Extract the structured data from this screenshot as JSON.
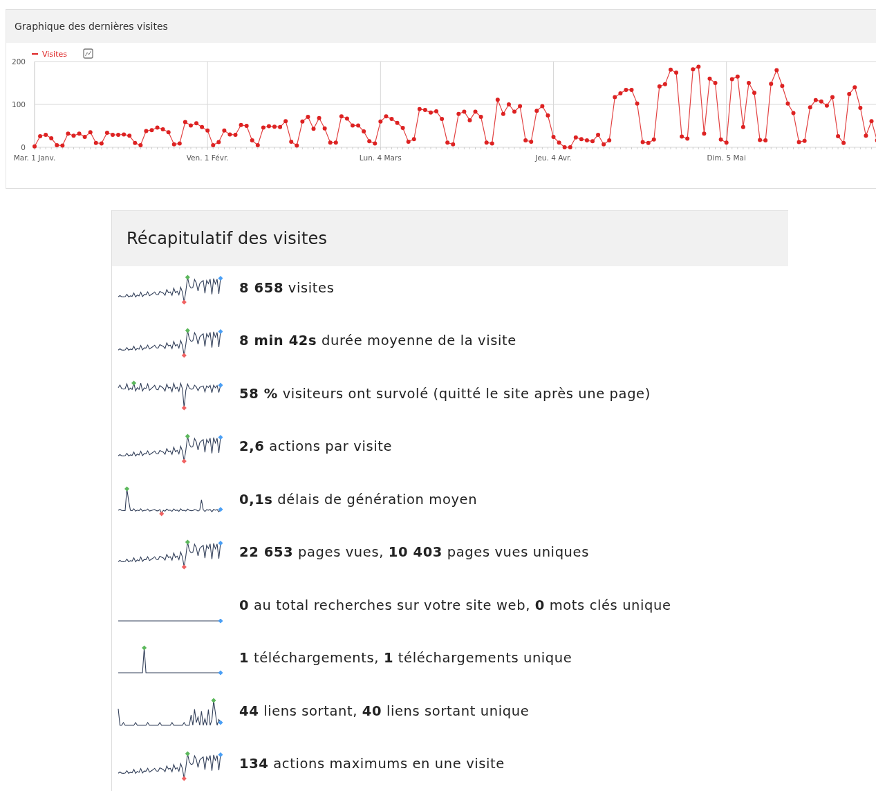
{
  "chart_panel": {
    "title": "Graphique des dernières visites",
    "chart_data": {
      "type": "line",
      "ylim": [
        0,
        200
      ],
      "yticks": [
        0,
        100,
        200
      ],
      "categories": [
        "Mar. 1 Janv.",
        null,
        null,
        null,
        null,
        null,
        null,
        null,
        null,
        null,
        null,
        null,
        null,
        null,
        null,
        null,
        null,
        null,
        null,
        null,
        null,
        null,
        null,
        null,
        null,
        null,
        null,
        null,
        null,
        null,
        null,
        "Ven. 1 Févr.",
        null,
        null,
        null,
        null,
        null,
        null,
        null,
        null,
        null,
        null,
        null,
        null,
        null,
        null,
        null,
        null,
        null,
        null,
        null,
        null,
        null,
        null,
        null,
        null,
        null,
        null,
        null,
        null,
        null,
        null,
        "Lun. 4 Mars",
        null,
        null,
        null,
        null,
        null,
        null,
        null,
        null,
        null,
        null,
        null,
        null,
        null,
        null,
        null,
        null,
        null,
        null,
        null,
        null,
        null,
        null,
        null,
        null,
        null,
        null,
        null,
        null,
        null,
        null,
        "Jeu. 4 Avr.",
        null,
        null,
        null,
        null,
        null,
        null,
        null,
        null,
        null,
        null,
        null,
        null,
        null,
        null,
        null,
        null,
        null,
        null,
        null,
        null,
        null,
        null,
        null,
        null,
        null,
        null,
        null,
        null,
        null,
        null,
        "Dim. 5 Mai",
        null,
        null,
        null,
        null,
        null,
        null,
        null,
        null,
        null,
        null,
        null,
        null,
        null,
        null,
        null,
        null,
        null,
        null,
        null,
        null,
        null,
        null,
        null,
        null,
        null,
        null,
        null
      ],
      "series": [
        {
          "name": "Visites",
          "color": "#dd2222",
          "marker": "circle",
          "values": [
            2,
            26,
            29,
            21,
            5,
            4,
            32,
            27,
            32,
            24,
            35,
            10,
            9,
            34,
            29,
            29,
            30,
            27,
            10,
            5,
            38,
            40,
            46,
            42,
            35,
            7,
            9,
            59,
            51,
            56,
            47,
            39,
            5,
            12,
            39,
            30,
            29,
            52,
            50,
            16,
            5,
            46,
            49,
            48,
            47,
            61,
            13,
            4,
            60,
            71,
            43,
            68,
            44,
            11,
            11,
            72,
            67,
            51,
            51,
            37,
            14,
            9,
            60,
            72,
            66,
            57,
            45,
            13,
            19,
            89,
            87,
            81,
            84,
            66,
            11,
            7,
            78,
            83,
            63,
            83,
            71,
            11,
            9,
            111,
            78,
            100,
            83,
            96,
            16,
            13,
            85,
            96,
            74,
            24,
            11,
            0,
            0,
            23,
            19,
            16,
            14,
            29,
            7,
            16,
            117,
            126,
            134,
            134,
            102,
            12,
            10,
            18,
            142,
            147,
            181,
            174,
            25,
            20,
            182,
            188,
            32,
            160,
            150,
            18,
            11,
            159,
            165,
            47,
            150,
            127,
            17,
            16,
            148,
            180,
            143,
            102,
            80,
            12,
            15,
            93,
            110,
            107,
            97,
            117,
            26,
            10,
            124,
            140,
            92,
            27,
            61,
            16
          ]
        }
      ]
    }
  },
  "summary_panel": {
    "title": "Récapitulatif des visites",
    "items": [
      {
        "text": "**8 658** visites"
      },
      {
        "text": "**8 min 42s** durée moyenne de la visite"
      },
      {
        "text": "**58 %** visiteurs ont survolé (quitté le site après une page)"
      },
      {
        "text": "**2,6** actions par visite"
      },
      {
        "text": "**0,1s** délais de génération moyen"
      },
      {
        "text": "**22 653** pages vues, **10 403** pages vues uniques"
      },
      {
        "text": "**0** au total recherches sur votre site web, **0** mots clés unique"
      },
      {
        "text": "**1** téléchargements, **1** téléchargements unique"
      },
      {
        "text": "**44** liens sortant, **40** liens sortant unique"
      },
      {
        "text": "**134** actions maximums en une visite"
      }
    ]
  }
}
